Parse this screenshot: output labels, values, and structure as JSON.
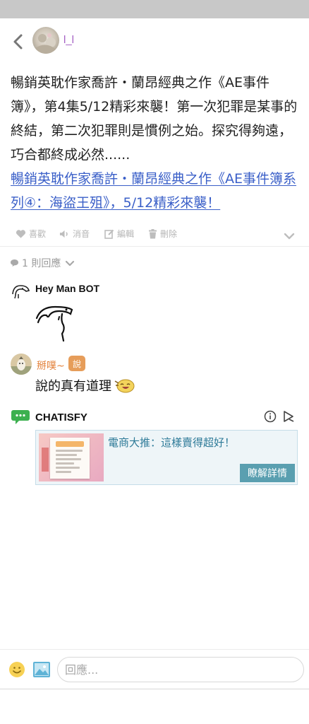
{
  "header": {
    "username": "l_l",
    "back_icon": "chevron-left-icon",
    "avatar_icon": "user-avatar"
  },
  "post": {
    "body_text": "暢銷英耽作家喬許・蘭昂經典之作《AE事件簿》，第4集5/12精彩來襲！第一次犯罪是某事的終結，第二次犯罪則是慣例之始。探究得夠遠，巧合都終成必然......",
    "link_text": "暢銷英耽作家喬許・蘭昂經典之作《AE事件簿系列④：海盜王殂》，5/12精彩來襲！",
    "link_color": "#3a5fc8"
  },
  "actions": {
    "like": "喜歡",
    "mute": "消音",
    "edit": "編輯",
    "delete": "刪除",
    "icons": [
      "heart-icon",
      "speaker-mute-icon",
      "edit-icon",
      "trash-icon",
      "chevron-down-icon"
    ]
  },
  "replies": {
    "count_label": "1 則回應",
    "comments": [
      {
        "name": "Hey Man BOT",
        "type": "sticker"
      },
      {
        "name": "掰噗~",
        "badge": "說",
        "text": "說的真有道理",
        "name_color": "#e3813a"
      }
    ]
  },
  "ad": {
    "brand": "CHATISFY",
    "title": "電商大推：這樣賣得超好！",
    "cta": "瞭解詳情",
    "accent": "#5a9fb0"
  },
  "composer": {
    "placeholder": "回應..."
  }
}
